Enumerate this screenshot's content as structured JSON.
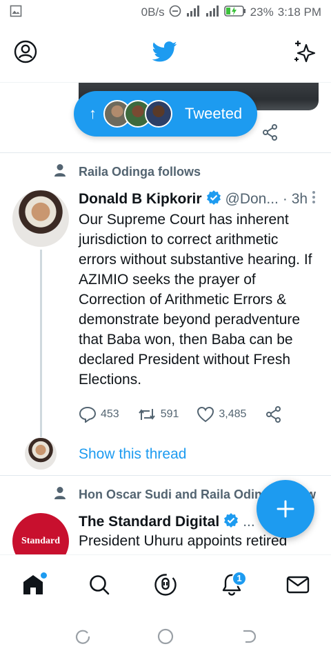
{
  "status_bar": {
    "speed": "0B/s",
    "battery": "23%",
    "time": "3:18 PM"
  },
  "header": {
    "profile_icon": "profile-icon",
    "logo": "twitter-bird-icon",
    "sparkle_icon": "sparkle-icon"
  },
  "new_tweets_pill": {
    "label": "Tweeted"
  },
  "tweets": [
    {
      "context": "Raila Odinga follows",
      "name": "Donald B Kipkorir",
      "handle": "@Don...",
      "time": "· 3h",
      "text": "Our Supreme Court has inherent jurisdiction to correct arithmetic errors without substantive hearing. If AZIMIO seeks the prayer of Correction of Arithmetic Errors & demonstrate beyond peradventure that Baba won, then Baba can be declared President without Fresh Elections.",
      "replies": "453",
      "retweets": "591",
      "likes": "3,485",
      "thread_link": "Show this thread"
    },
    {
      "context": "Hon Oscar Sudi and Raila Odinga follow",
      "name": "The Standard Digital",
      "handle": "...",
      "avatar_text": "Standard",
      "text": "President Uhuru appoints retired Vice Chief of Defence Forces"
    }
  ],
  "bottom_nav": {
    "notification_count": "1"
  },
  "colors": {
    "accent": "#1d9bf0",
    "text": "#0f1419",
    "muted": "#536471"
  }
}
